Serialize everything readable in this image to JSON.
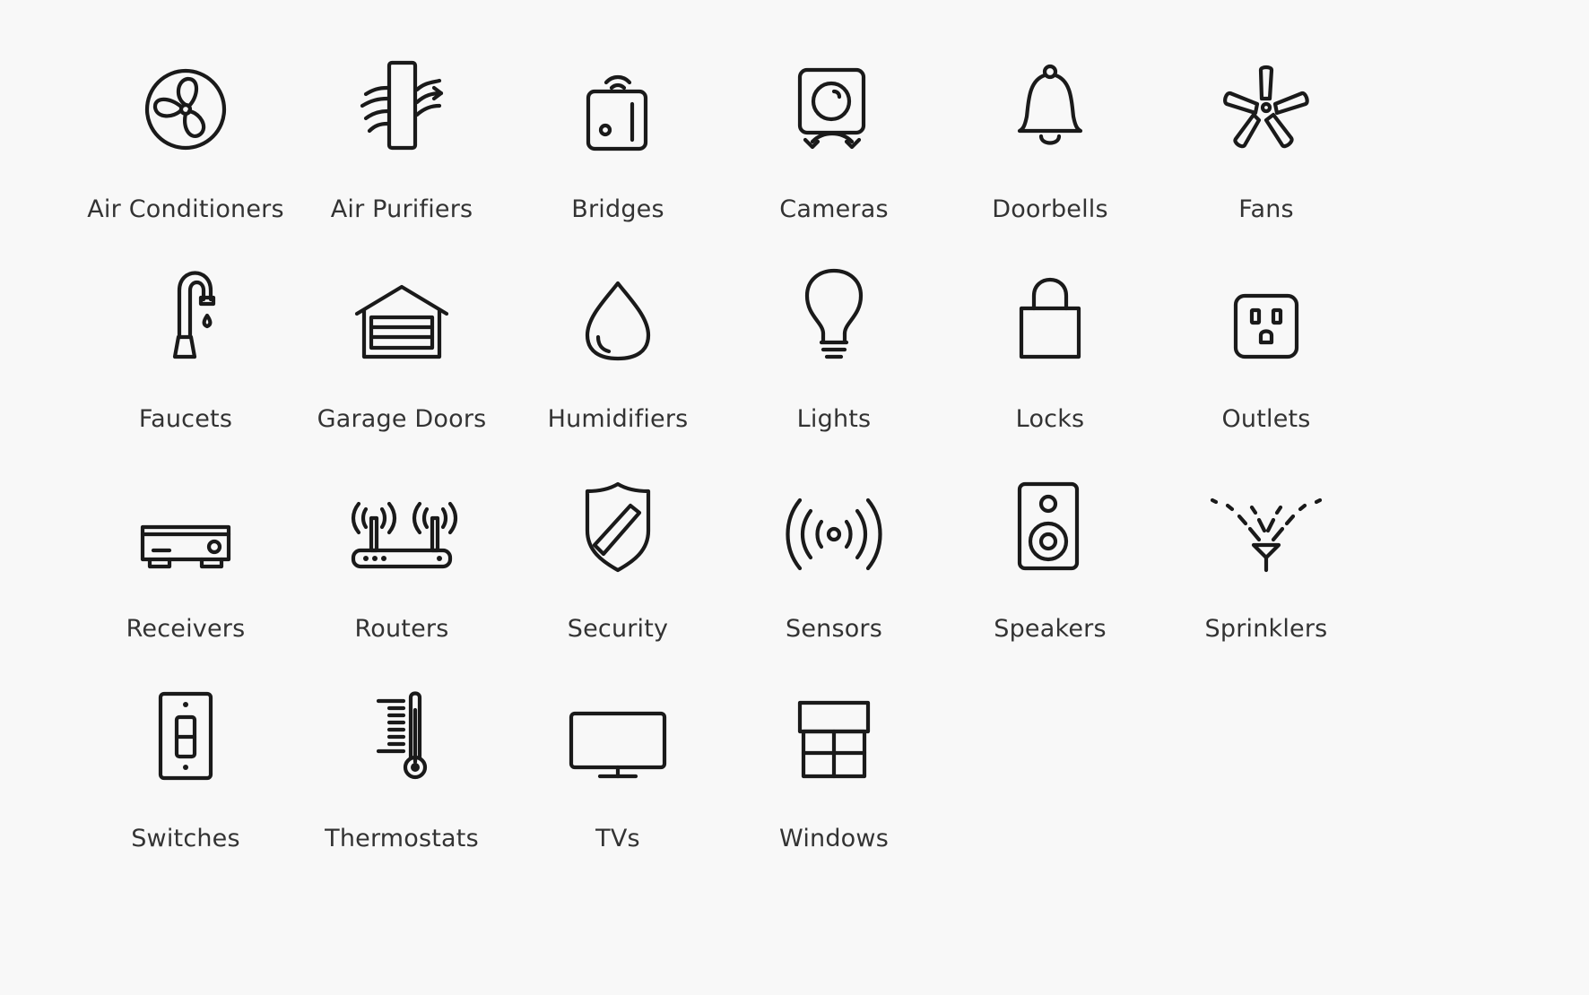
{
  "accessory_categories": [
    {
      "label": "Air Conditioners",
      "icon": "air-conditioner-fan-icon"
    },
    {
      "label": "Air Purifiers",
      "icon": "air-purifier-icon"
    },
    {
      "label": "Bridges",
      "icon": "bridge-hub-icon"
    },
    {
      "label": "Cameras",
      "icon": "camera-icon"
    },
    {
      "label": "Doorbells",
      "icon": "doorbell-icon"
    },
    {
      "label": "Fans",
      "icon": "ceiling-fan-icon"
    },
    {
      "label": "Faucets",
      "icon": "faucet-icon"
    },
    {
      "label": "Garage Doors",
      "icon": "garage-door-icon"
    },
    {
      "label": "Humidifiers",
      "icon": "water-drop-icon"
    },
    {
      "label": "Lights",
      "icon": "light-bulb-icon"
    },
    {
      "label": "Locks",
      "icon": "padlock-icon"
    },
    {
      "label": "Outlets",
      "icon": "power-outlet-icon"
    },
    {
      "label": "Receivers",
      "icon": "av-receiver-icon"
    },
    {
      "label": "Routers",
      "icon": "wifi-router-icon"
    },
    {
      "label": "Security",
      "icon": "security-shield-icon"
    },
    {
      "label": "Sensors",
      "icon": "sensor-waves-icon"
    },
    {
      "label": "Speakers",
      "icon": "speaker-icon"
    },
    {
      "label": "Sprinklers",
      "icon": "sprinkler-icon"
    },
    {
      "label": "Switches",
      "icon": "light-switch-icon"
    },
    {
      "label": "Thermostats",
      "icon": "thermometer-icon"
    },
    {
      "label": "TVs",
      "icon": "television-icon"
    },
    {
      "label": "Windows",
      "icon": "window-icon"
    }
  ],
  "colors": {
    "background": "#f8f8f8",
    "icon_stroke": "#1a1a1a",
    "label_text": "#333333"
  }
}
